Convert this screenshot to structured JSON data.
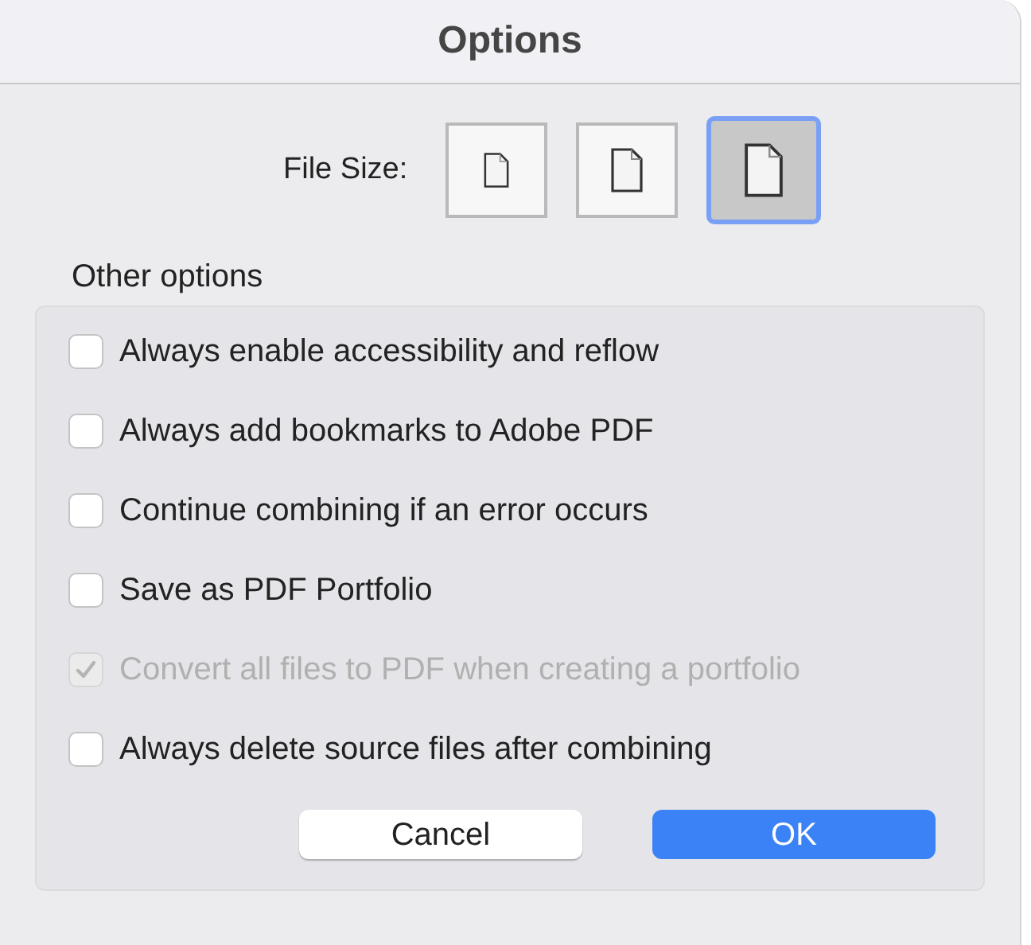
{
  "window": {
    "title": "Options"
  },
  "file_size": {
    "label": "File Size:",
    "options": [
      {
        "kind": "small",
        "selected": false
      },
      {
        "kind": "medium",
        "selected": false
      },
      {
        "kind": "large",
        "selected": true
      }
    ]
  },
  "other_options": {
    "heading": "Other options",
    "items": [
      {
        "label": "Always enable accessibility and reflow",
        "checked": false,
        "disabled": false
      },
      {
        "label": "Always add bookmarks to Adobe PDF",
        "checked": false,
        "disabled": false
      },
      {
        "label": "Continue combining if an error occurs",
        "checked": false,
        "disabled": false
      },
      {
        "label": "Save as PDF Portfolio",
        "checked": false,
        "disabled": false
      },
      {
        "label": "Convert all files to PDF when creating a portfolio",
        "checked": true,
        "disabled": true
      },
      {
        "label": "Always delete source files after combining",
        "checked": false,
        "disabled": false
      }
    ]
  },
  "buttons": [
    {
      "label": "Cancel",
      "kind": "secondary"
    },
    {
      "label": "OK",
      "kind": "primary"
    }
  ]
}
